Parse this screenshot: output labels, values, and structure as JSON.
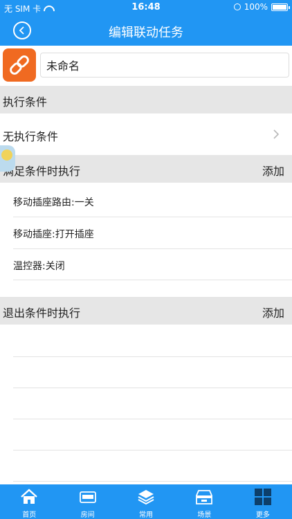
{
  "status_bar": {
    "carrier": "无 SIM 卡",
    "time": "16:48",
    "battery": "100%"
  },
  "nav": {
    "title": "编辑联动任务"
  },
  "task": {
    "name_value": "未命名",
    "icon": "link-icon"
  },
  "conditions": {
    "header": "执行条件",
    "row_label": "无执行条件"
  },
  "on_satisfy": {
    "header": "满足条件时执行",
    "add_label": "添加",
    "items": [
      "移动插座路由:一关",
      "移动插座:打开插座",
      "温控器:关闭"
    ]
  },
  "on_exit": {
    "header": "退出条件时执行",
    "add_label": "添加"
  },
  "tabbar": {
    "tabs": [
      {
        "label": "首页",
        "icon": "home-icon"
      },
      {
        "label": "房间",
        "icon": "room-icon"
      },
      {
        "label": "常用",
        "icon": "layers-icon"
      },
      {
        "label": "场景",
        "icon": "scene-icon"
      },
      {
        "label": "更多",
        "icon": "grid-icon"
      }
    ]
  },
  "colors": {
    "primary": "#2196f3",
    "task_icon_bg": "#f06a21",
    "section_bg": "#e6e6e6"
  }
}
